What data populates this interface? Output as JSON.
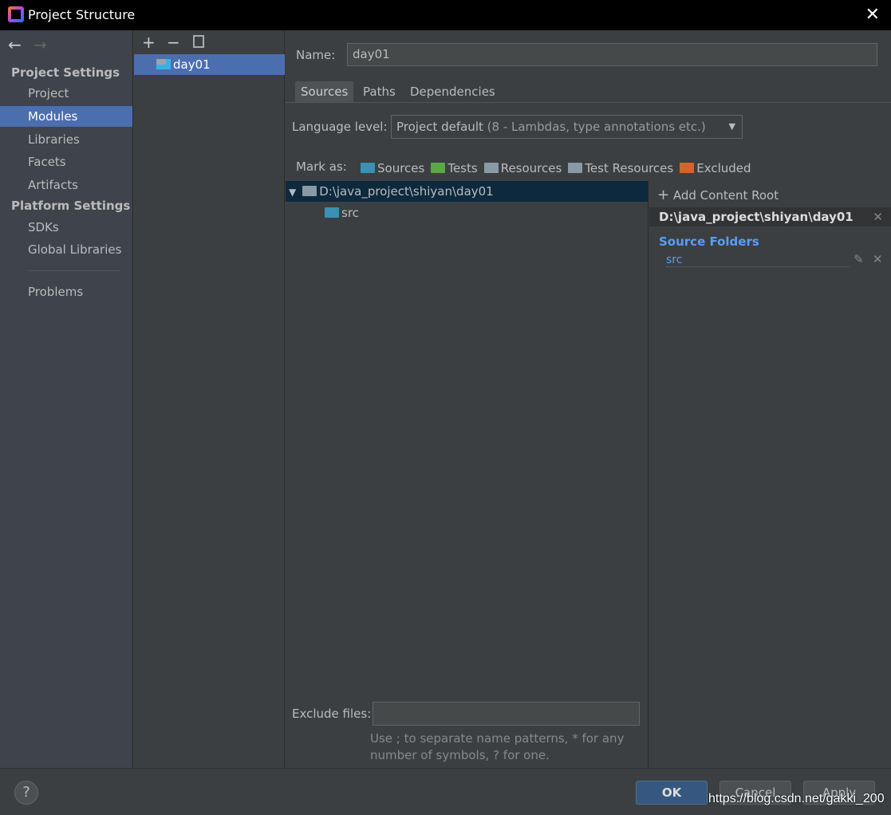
{
  "window": {
    "title": "Project Structure"
  },
  "sidebar": {
    "project_settings": "Project Settings",
    "items1": [
      "Project",
      "Modules",
      "Libraries",
      "Facets",
      "Artifacts"
    ],
    "platform_settings": "Platform Settings",
    "items2": [
      "SDKs",
      "Global Libraries"
    ],
    "problems": "Problems",
    "selected": "Modules"
  },
  "modules": {
    "items": [
      "day01"
    ]
  },
  "main": {
    "name_label": "Name:",
    "name_value": "day01",
    "tabs": [
      "Sources",
      "Paths",
      "Dependencies"
    ],
    "active_tab": "Sources",
    "language_label": "Language level:",
    "language_value": "Project default",
    "language_hint": "(8 - Lambdas, type annotations etc.)",
    "mark_as": "Mark as:",
    "marks": [
      {
        "label": "Sources",
        "color": "#3d8fb5"
      },
      {
        "label": "Tests",
        "color": "#5aa84a"
      },
      {
        "label": "Resources",
        "color": "#8a9aa5"
      },
      {
        "label": "Test Resources",
        "color": "#8a9aa5"
      },
      {
        "label": "Excluded",
        "color": "#d0662d"
      }
    ],
    "tree": {
      "root": "D:\\java_project\\shiyan\\day01",
      "child": "src"
    },
    "exclude_label": "Exclude files:",
    "exclude_value": "",
    "exclude_hint1": "Use ; to separate name patterns, * for any",
    "exclude_hint2": "number of symbols, ? for one."
  },
  "roots": {
    "add": "Add Content Root",
    "path": "D:\\java_project\\shiyan\\day01",
    "source_folders": "Source Folders",
    "src": "src"
  },
  "footer": {
    "ok": "OK",
    "cancel": "Cancel",
    "apply": "Apply",
    "help": "?",
    "watermark": "https://blog.csdn.net/gakki_200"
  }
}
